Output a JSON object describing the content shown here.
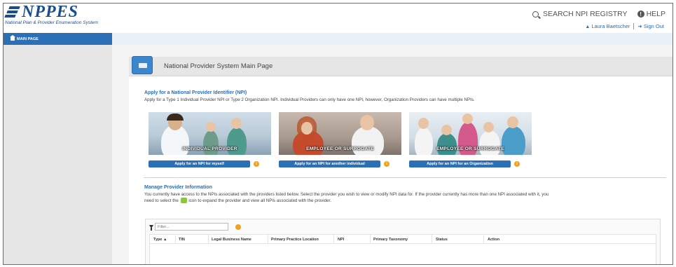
{
  "header": {
    "logo_text": "NPPES",
    "logo_tagline": "National Plan & Provider Enumeration System",
    "search_link": "SEARCH NPI REGISTRY",
    "help_link": "HELP",
    "user_name": "Laura Baetscher",
    "sign_out": "Sign Out"
  },
  "sidebar": {
    "items": [
      {
        "label": "MAIN PAGE",
        "icon": "home-icon"
      }
    ]
  },
  "main": {
    "page_title": "National Provider System Main Page",
    "apply_heading": "Apply for a National Provider Identifier (NPI)",
    "apply_text": "Apply for a Type 1 Individual Provider NPI or Type 2 Organization NPI. Individual Providers can only have one NPI, however, Organization Providers can have multiple NPIs.",
    "cards": [
      {
        "label": "INDIVIDUAL PROVIDER",
        "button": "Apply for an NPI for myself"
      },
      {
        "label": "EMPLOYEE OR SURROGATE",
        "button": "Apply for an NPI for another individual"
      },
      {
        "label": "EMPLOYEE OR SURROGATE",
        "button": "Apply for an NPI for an Organization"
      }
    ],
    "manage_heading": "Manage Provider Information",
    "manage_text_1": "You currently have access to the NPIs associated with the providers listed below. Select the provider you wish to view or modify NPI data for. If the provider currently has more than one NPI associated with it, you",
    "manage_text_2a": "need to select the",
    "manage_text_2b": "icon to expand the provider and view all NPIs associated with the provider."
  },
  "table": {
    "filter_placeholder": "Filter...",
    "columns": [
      "Type ▲",
      "TIN",
      "Legal Business Name",
      "Primary Practice Location",
      "NPI",
      "Primary Taxonomy",
      "Status",
      "Action"
    ]
  },
  "colors": {
    "brand_blue": "#1b4c8c",
    "button_blue": "#2b70b6",
    "info_orange": "#f0a21b",
    "expand_green": "#8cc63f"
  }
}
